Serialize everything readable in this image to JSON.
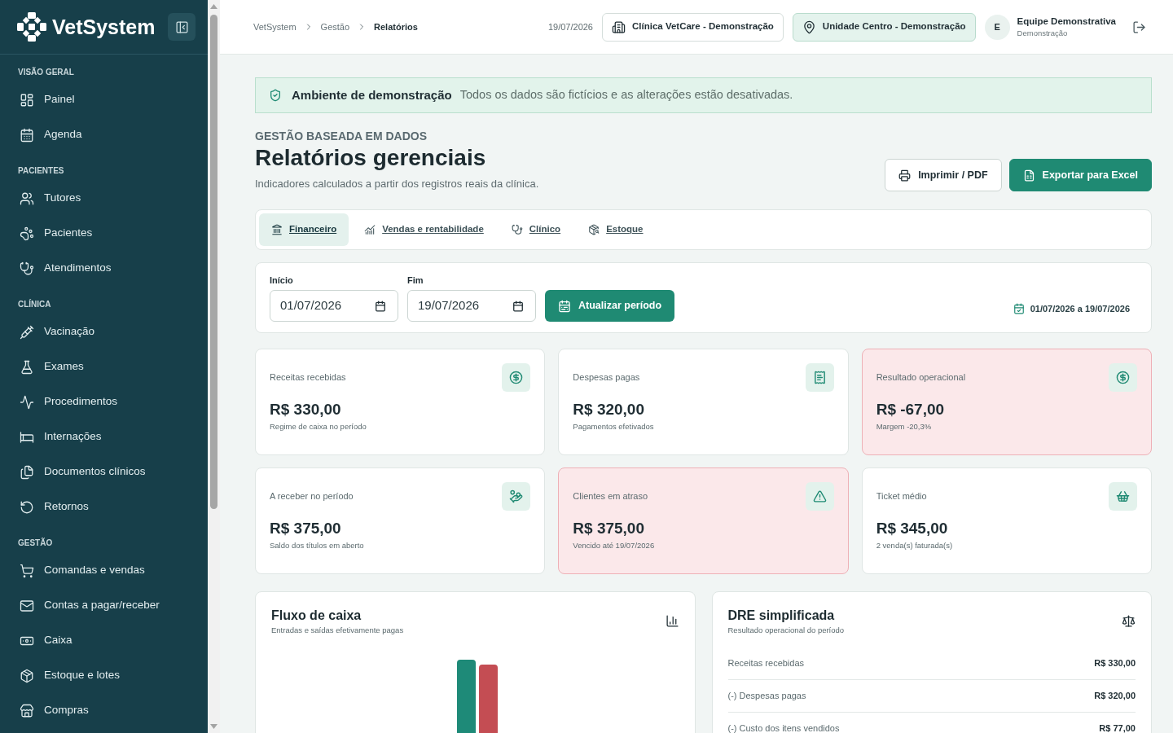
{
  "sidebar": {
    "brand": "VetSystem",
    "sections": [
      {
        "title": "VISÃO GERAL",
        "items": [
          {
            "label": "Painel",
            "selected": false
          },
          {
            "label": "Agenda",
            "selected": false
          }
        ]
      },
      {
        "title": "PACIENTES",
        "items": [
          {
            "label": "Tutores",
            "selected": false
          },
          {
            "label": "Pacientes",
            "selected": false
          },
          {
            "label": "Atendimentos",
            "selected": false
          }
        ]
      },
      {
        "title": "CLÍNICA",
        "items": [
          {
            "label": "Vacinação",
            "selected": false
          },
          {
            "label": "Exames",
            "selected": false
          },
          {
            "label": "Procedimentos",
            "selected": false
          },
          {
            "label": "Internações",
            "selected": false
          },
          {
            "label": "Documentos clínicos",
            "selected": false
          },
          {
            "label": "Retornos",
            "selected": false
          }
        ]
      },
      {
        "title": "GESTÃO",
        "items": [
          {
            "label": "Comandas e vendas",
            "selected": false
          },
          {
            "label": "Contas a pagar/receber",
            "selected": false
          },
          {
            "label": "Caixa",
            "selected": false
          },
          {
            "label": "Estoque e lotes",
            "selected": false
          },
          {
            "label": "Compras",
            "selected": false
          }
        ]
      }
    ]
  },
  "topbar": {
    "breadcrumb": [
      {
        "label": "VetSystem",
        "current": false
      },
      {
        "label": "Gestão",
        "current": false
      },
      {
        "label": "Relatórios",
        "current": true
      }
    ],
    "date": "19/07/2026",
    "clinic": "Clínica VetCare - Demonstração",
    "unit": "Unidade Centro - Demonstração",
    "user": {
      "initial": "E",
      "name": "Equipe Demonstrativa",
      "role": "Demonstração"
    }
  },
  "banner": {
    "title": "Ambiente de demonstração",
    "message": "Todos os dados são fictícios e as alterações estão desativadas."
  },
  "header": {
    "eyebrow": "GESTÃO BASEADA EM DADOS",
    "title": "Relatórios gerenciais",
    "subtitle": "Indicadores calculados a partir dos registros reais da clínica.",
    "buttons": [
      {
        "label": "Imprimir / PDF",
        "kind": "outline"
      },
      {
        "label": "Exportar para Excel",
        "kind": "primary"
      }
    ]
  },
  "tabs": [
    {
      "label": "Financeiro",
      "selected": true
    },
    {
      "label": "Vendas e rentabilidade",
      "selected": false
    },
    {
      "label": "Clínico",
      "selected": false
    },
    {
      "label": "Estoque",
      "selected": false
    }
  ],
  "period": {
    "fields": [
      {
        "label": "Início",
        "value": "01/07/2026"
      },
      {
        "label": "Fim",
        "value": "19/07/2026"
      }
    ],
    "button": "Atualizar período",
    "range": "01/07/2026 a 19/07/2026"
  },
  "cards": [
    {
      "label": "Receitas recebidas",
      "value": "R$ 330,00",
      "note": "Regime de caixa no período",
      "alert": false
    },
    {
      "label": "Despesas pagas",
      "value": "R$ 320,00",
      "note": "Pagamentos efetivados",
      "alert": false
    },
    {
      "label": "Resultado operacional",
      "value": "R$ -67,00",
      "note": "Margem -20,3%",
      "alert": true
    },
    {
      "label": "A receber no período",
      "value": "R$ 375,00",
      "note": "Saldo dos títulos em aberto",
      "alert": false
    },
    {
      "label": "Clientes em atraso",
      "value": "R$ 375,00",
      "note": "Vencido até 19/07/2026",
      "alert": true
    },
    {
      "label": "Ticket médio",
      "value": "R$ 345,00",
      "note": "2 venda(s) faturada(s)",
      "alert": false
    }
  ],
  "cash_flow": {
    "title": "Fluxo de caixa",
    "subtitle": "Entradas e saídas efetivamente pagas"
  },
  "dre": {
    "title": "DRE simplificada",
    "subtitle": "Resultado operacional do período",
    "rows": [
      {
        "label": "Receitas recebidas",
        "value": "R$ 330,00"
      },
      {
        "label": "(-) Despesas pagas",
        "value": "R$ 320,00"
      },
      {
        "label": "(-) Custo dos itens vendidos",
        "value": "R$ 77,00"
      }
    ]
  }
}
